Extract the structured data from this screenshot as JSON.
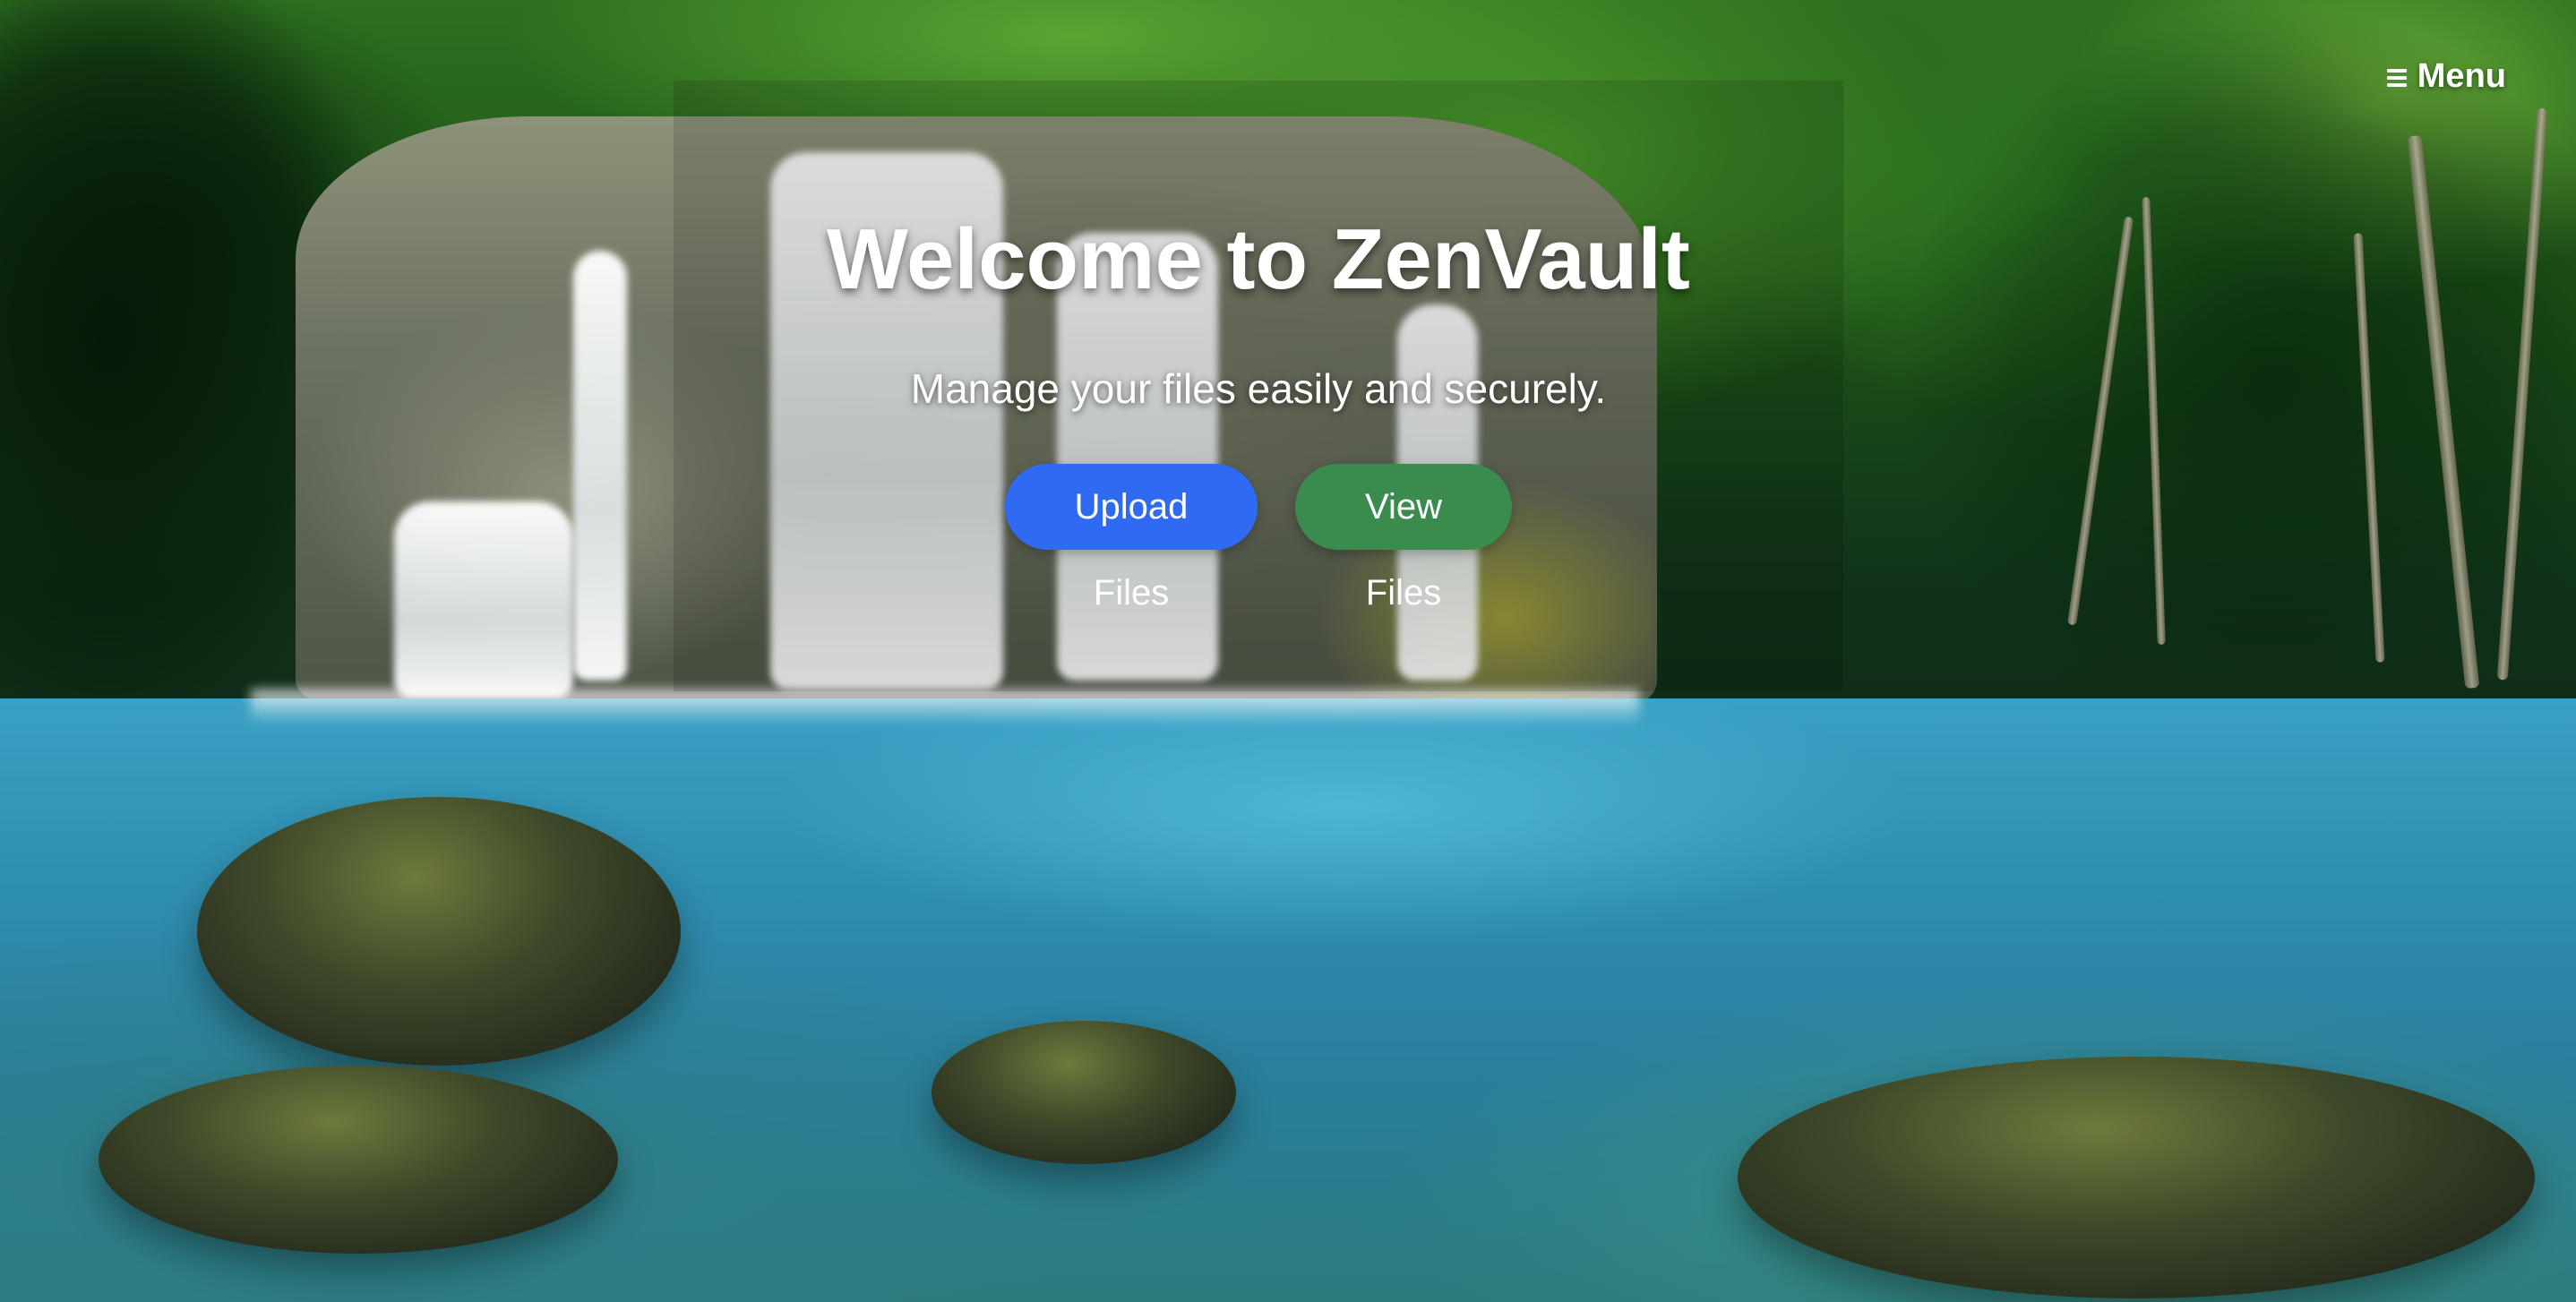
{
  "header": {
    "menu_label": "Menu",
    "menu_icon": "hamburger-icon"
  },
  "hero": {
    "title": "Welcome to ZenVault",
    "subtitle": "Manage your files easily and securely.",
    "upload_button": "Upload Files",
    "view_button": "View Files"
  },
  "background": {
    "description_icon": "waterfall-background",
    "accent_upload": "#2f6bf2",
    "accent_view": "#3b8a4e"
  }
}
